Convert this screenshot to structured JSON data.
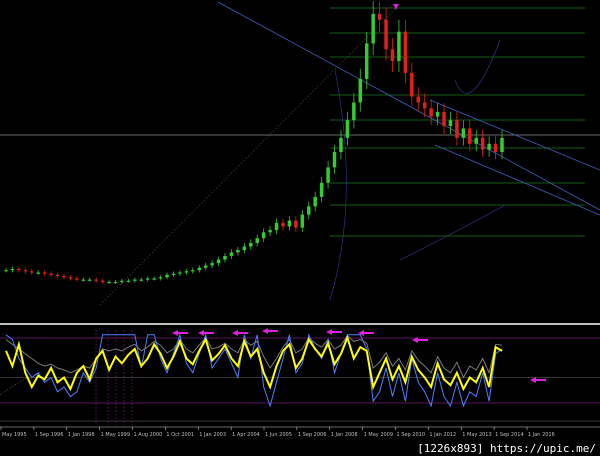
{
  "chart_data": [
    {
      "type": "candlestick",
      "name_hint": "price",
      "x_labels": [
        "May 1995",
        "1 Sep 1996",
        "1 Jan 1998",
        "1 May 1999",
        "1 Aug 2000",
        "1 Oct 2001",
        "1 Jan 2003",
        "1 Apr 2004",
        "1 Jun 2005",
        "1 Sep 2006",
        "1 Jan 2008",
        "1 May 2009",
        "1 Sep 2010",
        "1 Jan 2012",
        "1 May 2013",
        "1 Sep 2014",
        "1 Jan 2016"
      ],
      "close": [
        38,
        39,
        38,
        37,
        36,
        36,
        35,
        34,
        33,
        32,
        31,
        30,
        30,
        30,
        29,
        28,
        28,
        28,
        29,
        29,
        30,
        30,
        31,
        31,
        32,
        34,
        35,
        36,
        37,
        38,
        40,
        42,
        44,
        47,
        50,
        53,
        55,
        58,
        61,
        65,
        70,
        72,
        78,
        75,
        80,
        74,
        85,
        92,
        100,
        112,
        125,
        138,
        150,
        165,
        180,
        200,
        230,
        255,
        250,
        225,
        215,
        240,
        205,
        185,
        180,
        175,
        168,
        172,
        160,
        165,
        150,
        158,
        145,
        150,
        140,
        145,
        138,
        150
      ],
      "colors": {
        "up": "#33cc33",
        "down": "#e02020"
      }
    },
    {
      "type": "line",
      "name_hint": "oscillator",
      "ylim": [
        0,
        100
      ],
      "series": [
        {
          "role": "main",
          "color": "#ffff00",
          "values": [
            78,
            62,
            85,
            55,
            40,
            52,
            48,
            60,
            45,
            50,
            38,
            55,
            62,
            48,
            70,
            78,
            58,
            72,
            65,
            74,
            80,
            62,
            70,
            85,
            75,
            60,
            72,
            88,
            70,
            64,
            78,
            90,
            68,
            75,
            84,
            70,
            62,
            88,
            72,
            80,
            55,
            40,
            62,
            78,
            85,
            60,
            70,
            90,
            80,
            72,
            86,
            64,
            75,
            92,
            70,
            82,
            78,
            40,
            55,
            70,
            48,
            62,
            45,
            72,
            58,
            50,
            40,
            65,
            48,
            42,
            55,
            38,
            50,
            45,
            60,
            40,
            82,
            78
          ]
        },
        {
          "role": "signal",
          "color": "#4f7fff",
          "values": [
            95,
            90,
            70,
            60,
            50,
            55,
            45,
            50,
            35,
            40,
            30,
            35,
            55,
            45,
            60,
            95,
            95,
            95,
            95,
            95,
            95,
            60,
            95,
            95,
            70,
            55,
            75,
            95,
            65,
            55,
            75,
            95,
            60,
            70,
            80,
            65,
            50,
            95,
            70,
            95,
            40,
            20,
            45,
            70,
            95,
            55,
            65,
            95,
            80,
            70,
            90,
            55,
            75,
            95,
            95,
            95,
            80,
            25,
            35,
            60,
            30,
            55,
            25,
            70,
            45,
            35,
            20,
            55,
            30,
            20,
            45,
            20,
            35,
            30,
            55,
            25,
            75,
            80
          ]
        },
        {
          "role": "upper",
          "color": "#7a7a7a",
          "values": [
            90,
            85,
            80,
            75,
            70,
            65,
            62,
            64,
            60,
            58,
            55,
            58,
            62,
            60,
            70,
            80,
            78,
            80,
            78,
            82,
            85,
            78,
            82,
            88,
            84,
            76,
            80,
            90,
            80,
            76,
            84,
            92,
            80,
            82,
            86,
            80,
            76,
            90,
            84,
            88,
            72,
            60,
            70,
            82,
            90,
            76,
            80,
            92,
            86,
            82,
            90,
            80,
            84,
            94,
            88,
            90,
            86,
            60,
            66,
            76,
            62,
            70,
            58,
            78,
            68,
            62,
            55,
            72,
            60,
            55,
            66,
            50,
            62,
            58,
            70,
            55,
            85,
            84
          ]
        }
      ],
      "annotations": [
        "magenta-arrow",
        "magenta-arrow",
        "magenta-arrow",
        "magenta-arrow",
        "magenta-arrow",
        "magenta-arrow",
        "magenta-arrow",
        "magenta-arrow"
      ]
    }
  ],
  "footer": {
    "watermark": "[1226x893] https://upic.me/"
  }
}
